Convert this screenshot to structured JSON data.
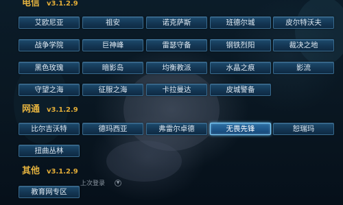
{
  "sections": {
    "telecom": {
      "title": "电信",
      "version": "v3.1.2.9",
      "servers": [
        "艾欧尼亚",
        "祖安",
        "诺克萨斯",
        "班德尔城",
        "皮尔特沃夫",
        "战争学院",
        "巨神峰",
        "雷瑟守备",
        "钢铁烈阳",
        "裁决之地",
        "黑色玫瑰",
        "暗影岛",
        "均衡教派",
        "水晶之痕",
        "影流",
        "守望之海",
        "征服之海",
        "卡拉曼达",
        "皮城警备"
      ]
    },
    "netcom": {
      "title": "网通",
      "version": "v3.1.2.9",
      "servers": [
        "比尔吉沃特",
        "德玛西亚",
        "弗雷尔卓德",
        "无畏先锋",
        "恕瑞玛",
        "扭曲丛林"
      ],
      "selected": "无畏先锋"
    },
    "other": {
      "title": "其他",
      "version": "v3.1.2.9",
      "servers": [
        "教育网专区"
      ]
    }
  },
  "footer": {
    "last_login_label": "上次登录"
  },
  "colors": {
    "section_title": "#e5b33f",
    "button_bg": "#143653",
    "button_border": "#3a6c90",
    "selected_border": "#7fd2ff"
  }
}
